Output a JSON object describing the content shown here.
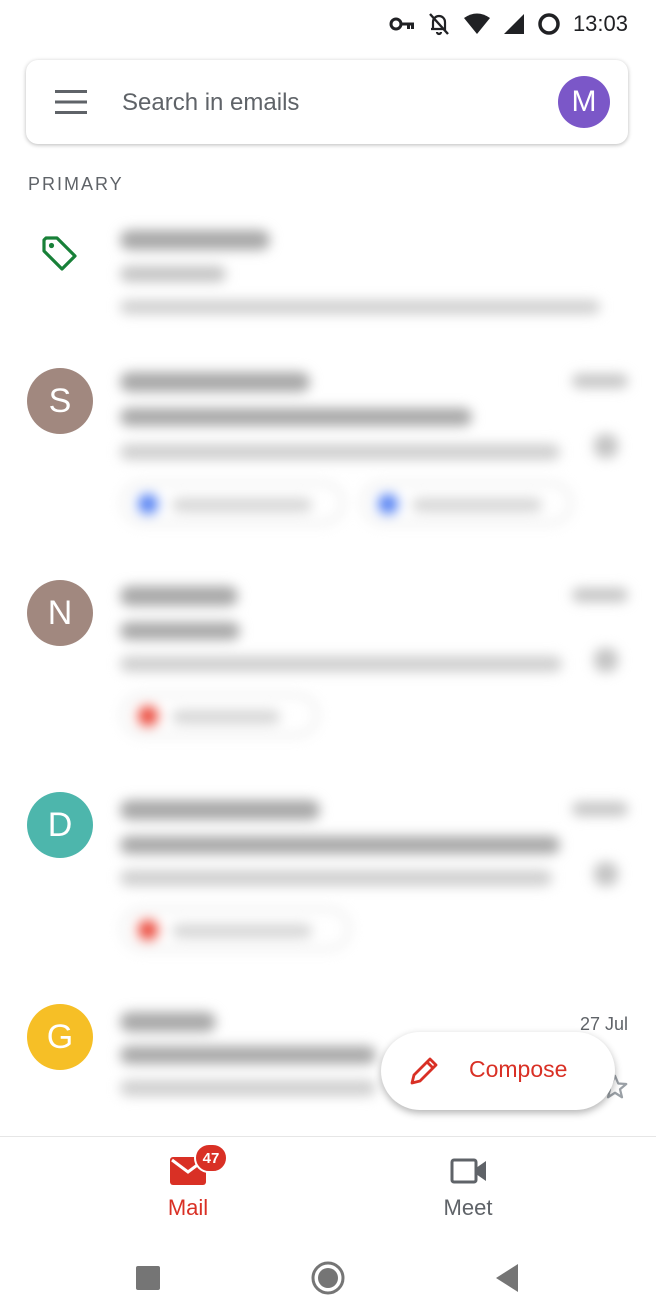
{
  "status_bar": {
    "time": "13:03"
  },
  "search": {
    "placeholder": "Search in emails",
    "avatar_letter": "M"
  },
  "section": {
    "label": "PRIMARY"
  },
  "emails": [
    {
      "avatar_letter": "S",
      "avatar_color": "#a1887f"
    },
    {
      "avatar_letter": "N",
      "avatar_color": "#a1887f"
    },
    {
      "avatar_letter": "D",
      "avatar_color": "#4db6ac"
    },
    {
      "avatar_letter": "G",
      "avatar_color": "#f6bf26",
      "date": "27 Jul"
    }
  ],
  "compose": {
    "label": "Compose"
  },
  "bottom_nav": {
    "mail": {
      "label": "Mail",
      "badge": "47"
    },
    "meet": {
      "label": "Meet"
    }
  },
  "colors": {
    "accent": "#d93025",
    "promo_tag": "#188038"
  }
}
